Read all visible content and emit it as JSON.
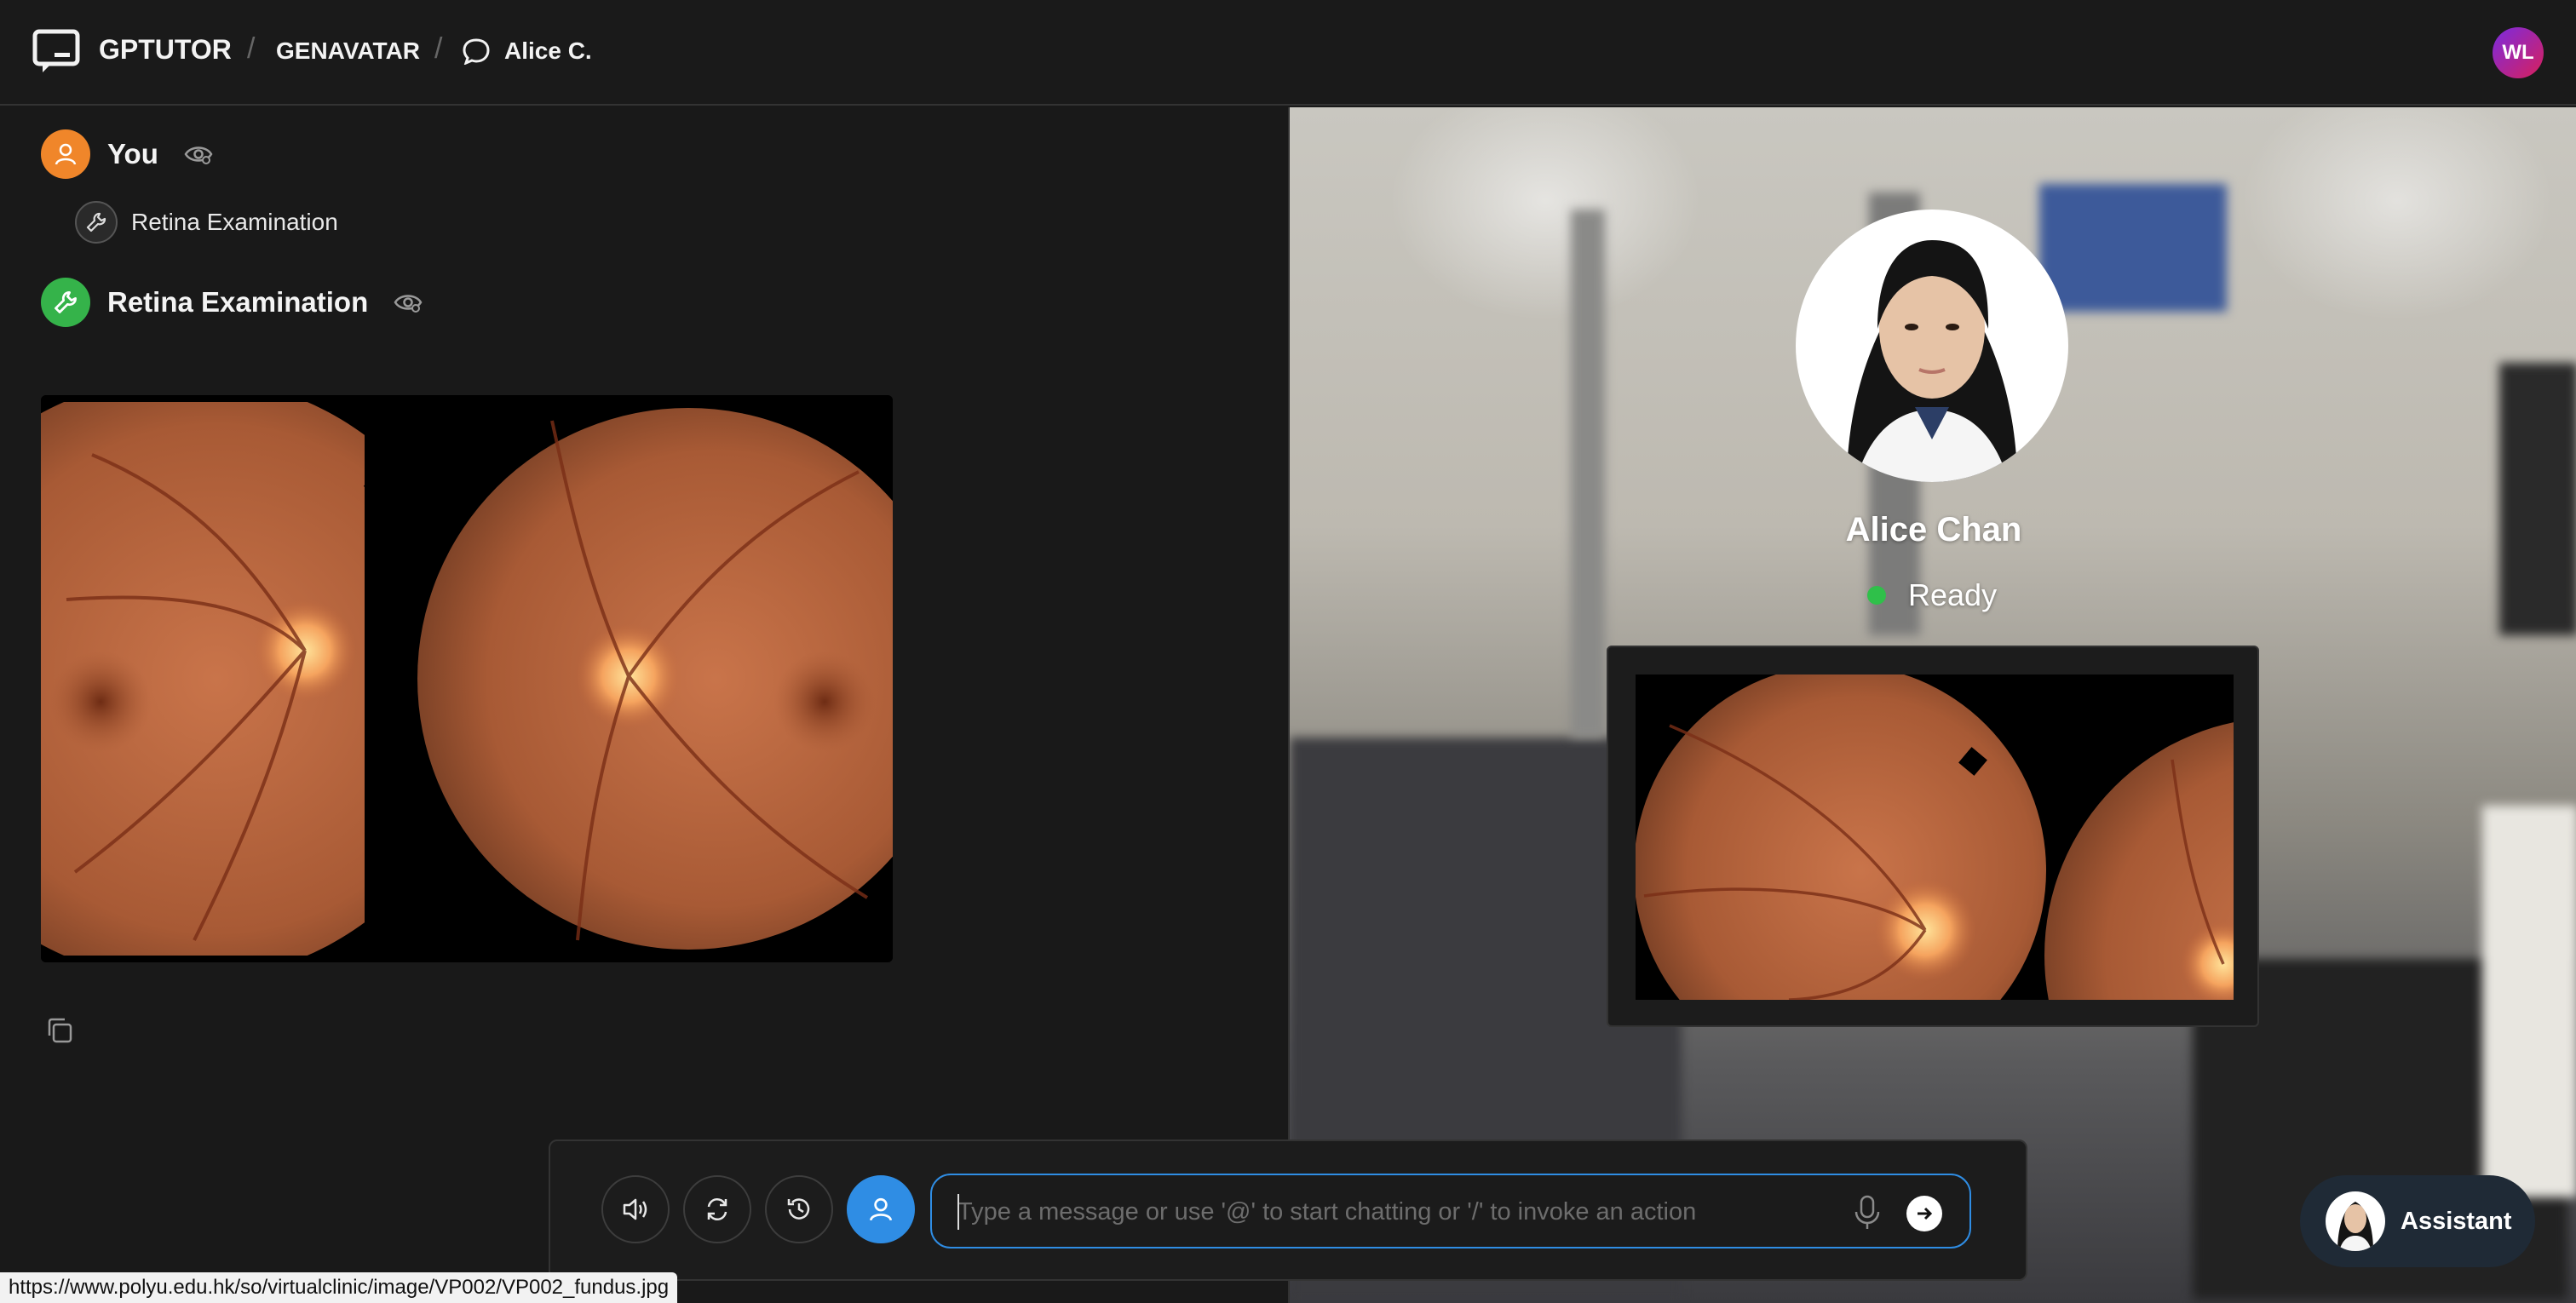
{
  "header": {
    "app_name": "GPTUTOR",
    "section": "GENAVATAR",
    "chat_title": "Alice C.",
    "user_initials": "WL"
  },
  "conversation": {
    "user_message": {
      "author": "You",
      "tool_call_label": "Retina Examination"
    },
    "tool_message": {
      "author": "Retina Examination",
      "image_description_icon": "fundus-image"
    }
  },
  "avatar_panel": {
    "name": "Alice Chan",
    "status": "Ready",
    "status_color": "#2fc04a"
  },
  "assistant_button": {
    "label": "Assistant"
  },
  "composer": {
    "placeholder": "Type a message or use '@' to start chatting or '/' to invoke an action",
    "value": ""
  },
  "status_url": "https://www.polyu.edu.hk/so/virtualclinic/image/VP002/VP002_fundus.jpg",
  "colors": {
    "accent_blue": "#2f8de4",
    "user_orange": "#f0862a",
    "tool_green": "#35b34a"
  }
}
